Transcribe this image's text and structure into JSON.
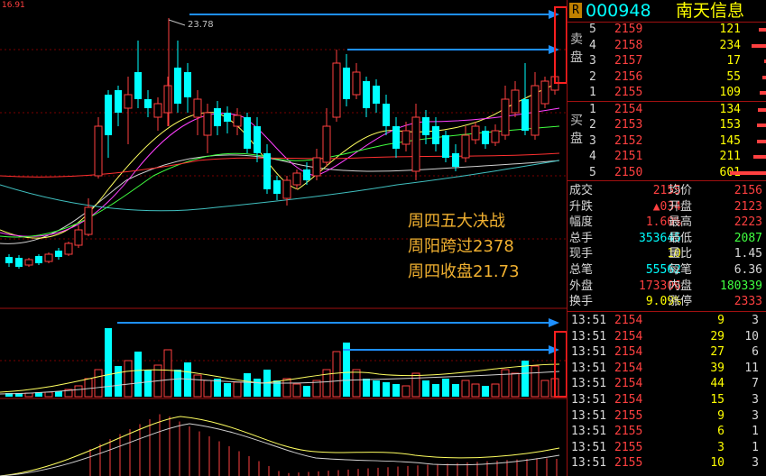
{
  "chart_meta": {
    "corner_value": "16.91",
    "high_label": "23.78"
  },
  "annotation": {
    "lines": [
      "周四五大决战",
      "周阳跨过2378",
      "周四收盘21.73"
    ]
  },
  "header": {
    "badge": "R",
    "code": "000948",
    "name": "南天信息"
  },
  "order_book": {
    "sell_label": "卖盘",
    "buy_label": "买盘",
    "sell": [
      {
        "level": "5",
        "price": "2159",
        "vol": "121"
      },
      {
        "level": "4",
        "price": "2158",
        "vol": "234"
      },
      {
        "level": "3",
        "price": "2157",
        "vol": "17"
      },
      {
        "level": "2",
        "price": "2156",
        "vol": "55"
      },
      {
        "level": "1",
        "price": "2155",
        "vol": "109"
      }
    ],
    "buy": [
      {
        "level": "1",
        "price": "2154",
        "vol": "134"
      },
      {
        "level": "2",
        "price": "2153",
        "vol": "153"
      },
      {
        "level": "3",
        "price": "2152",
        "vol": "145"
      },
      {
        "level": "4",
        "price": "2151",
        "vol": "211"
      },
      {
        "level": "5",
        "price": "2150",
        "vol": "601"
      }
    ]
  },
  "stats": [
    {
      "l1": "成交",
      "v1": "2155",
      "l2": "均价",
      "v2": "2156",
      "c1": "rd",
      "c2": "rd"
    },
    {
      "l1": "升跌",
      "v1": "▲034",
      "l2": "开盘",
      "v2": "2123",
      "c1": "rd",
      "c2": "rd"
    },
    {
      "l1": "幅度",
      "v1": "1.60%",
      "l2": "最高",
      "v2": "2223",
      "c1": "rd",
      "c2": "rd"
    },
    {
      "l1": "总手",
      "v1": "353645",
      "l2": "最低",
      "v2": "2087",
      "c1": "cy",
      "c2": "gr"
    },
    {
      "l1": "现手",
      "v1": "10",
      "l2": "量比",
      "v2": "1.45",
      "c1": "yl",
      "c2": "wh"
    },
    {
      "l1": "总笔",
      "v1": "55562",
      "l2": "每笔",
      "v2": "6.36",
      "c1": "cy",
      "c2": "wh"
    },
    {
      "l1": "外盘",
      "v1": "173306",
      "l2": "内盘",
      "v2": "180339",
      "c1": "rd",
      "c2": "gr"
    },
    {
      "l1": "换手",
      "v1": "9.09%",
      "l2": "涨停",
      "v2": "2333",
      "c1": "yl",
      "c2": "rd"
    }
  ],
  "ticks": [
    {
      "time": "13:51",
      "price": "2154",
      "vol": "9",
      "n": "3",
      "pc": "rd"
    },
    {
      "time": "13:51",
      "price": "2154",
      "vol": "29",
      "n": "10",
      "pc": "rd"
    },
    {
      "time": "13:51",
      "price": "2154",
      "vol": "27",
      "n": "6",
      "pc": "rd"
    },
    {
      "time": "13:51",
      "price": "2154",
      "vol": "39",
      "n": "11",
      "pc": "rd"
    },
    {
      "time": "13:51",
      "price": "2154",
      "vol": "44",
      "n": "7",
      "pc": "rd"
    },
    {
      "time": "13:51",
      "price": "2154",
      "vol": "15",
      "n": "3",
      "pc": "rd"
    },
    {
      "time": "13:51",
      "price": "2155",
      "vol": "9",
      "n": "3",
      "pc": "rd"
    },
    {
      "time": "13:51",
      "price": "2155",
      "vol": "6",
      "n": "1",
      "pc": "rd"
    },
    {
      "time": "13:51",
      "price": "2155",
      "vol": "3",
      "n": "1",
      "pc": "rd"
    },
    {
      "time": "13:51",
      "price": "2155",
      "vol": "10",
      "n": "3",
      "pc": "rd"
    }
  ],
  "colors": {
    "up": "#ff4040",
    "down": "#00ffff",
    "arrow": "#1e90ff",
    "highlight_box": "#ff2020"
  }
}
